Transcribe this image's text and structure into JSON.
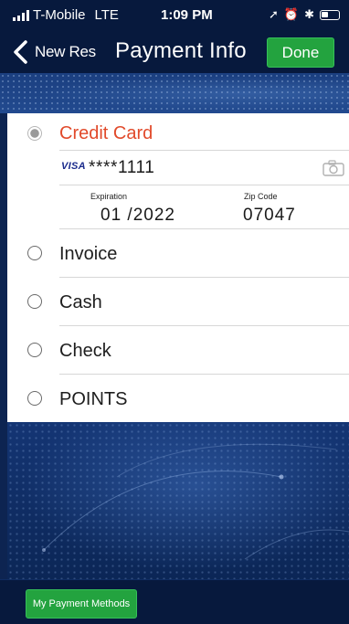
{
  "status_bar": {
    "carrier": "T-Mobile",
    "network": "LTE",
    "time": "1:09 PM"
  },
  "nav": {
    "back_label": "New Res",
    "title": "Payment Info",
    "done_label": "Done"
  },
  "payment_options": [
    {
      "label": "Credit Card",
      "selected": true
    },
    {
      "label": "Invoice",
      "selected": false
    },
    {
      "label": "Cash",
      "selected": false
    },
    {
      "label": "Check",
      "selected": false
    },
    {
      "label": "POINTS",
      "selected": false
    }
  ],
  "card": {
    "brand": "VISA",
    "number": "****1111",
    "expiration_label": "Expiration",
    "expiration_value": "01  /2022",
    "zip_label": "Zip Code",
    "zip_value": "07047"
  },
  "footer": {
    "methods_button": "My Payment Methods"
  },
  "colors": {
    "header_bg": "#07193d",
    "accent_green": "#23a33f",
    "selected_label": "#e14a2b"
  },
  "icons": [
    "signal-icon",
    "location-arrow-icon",
    "alarm-icon",
    "bluetooth-icon",
    "battery-icon",
    "back-chevron-icon",
    "visa-icon",
    "camera-icon"
  ]
}
